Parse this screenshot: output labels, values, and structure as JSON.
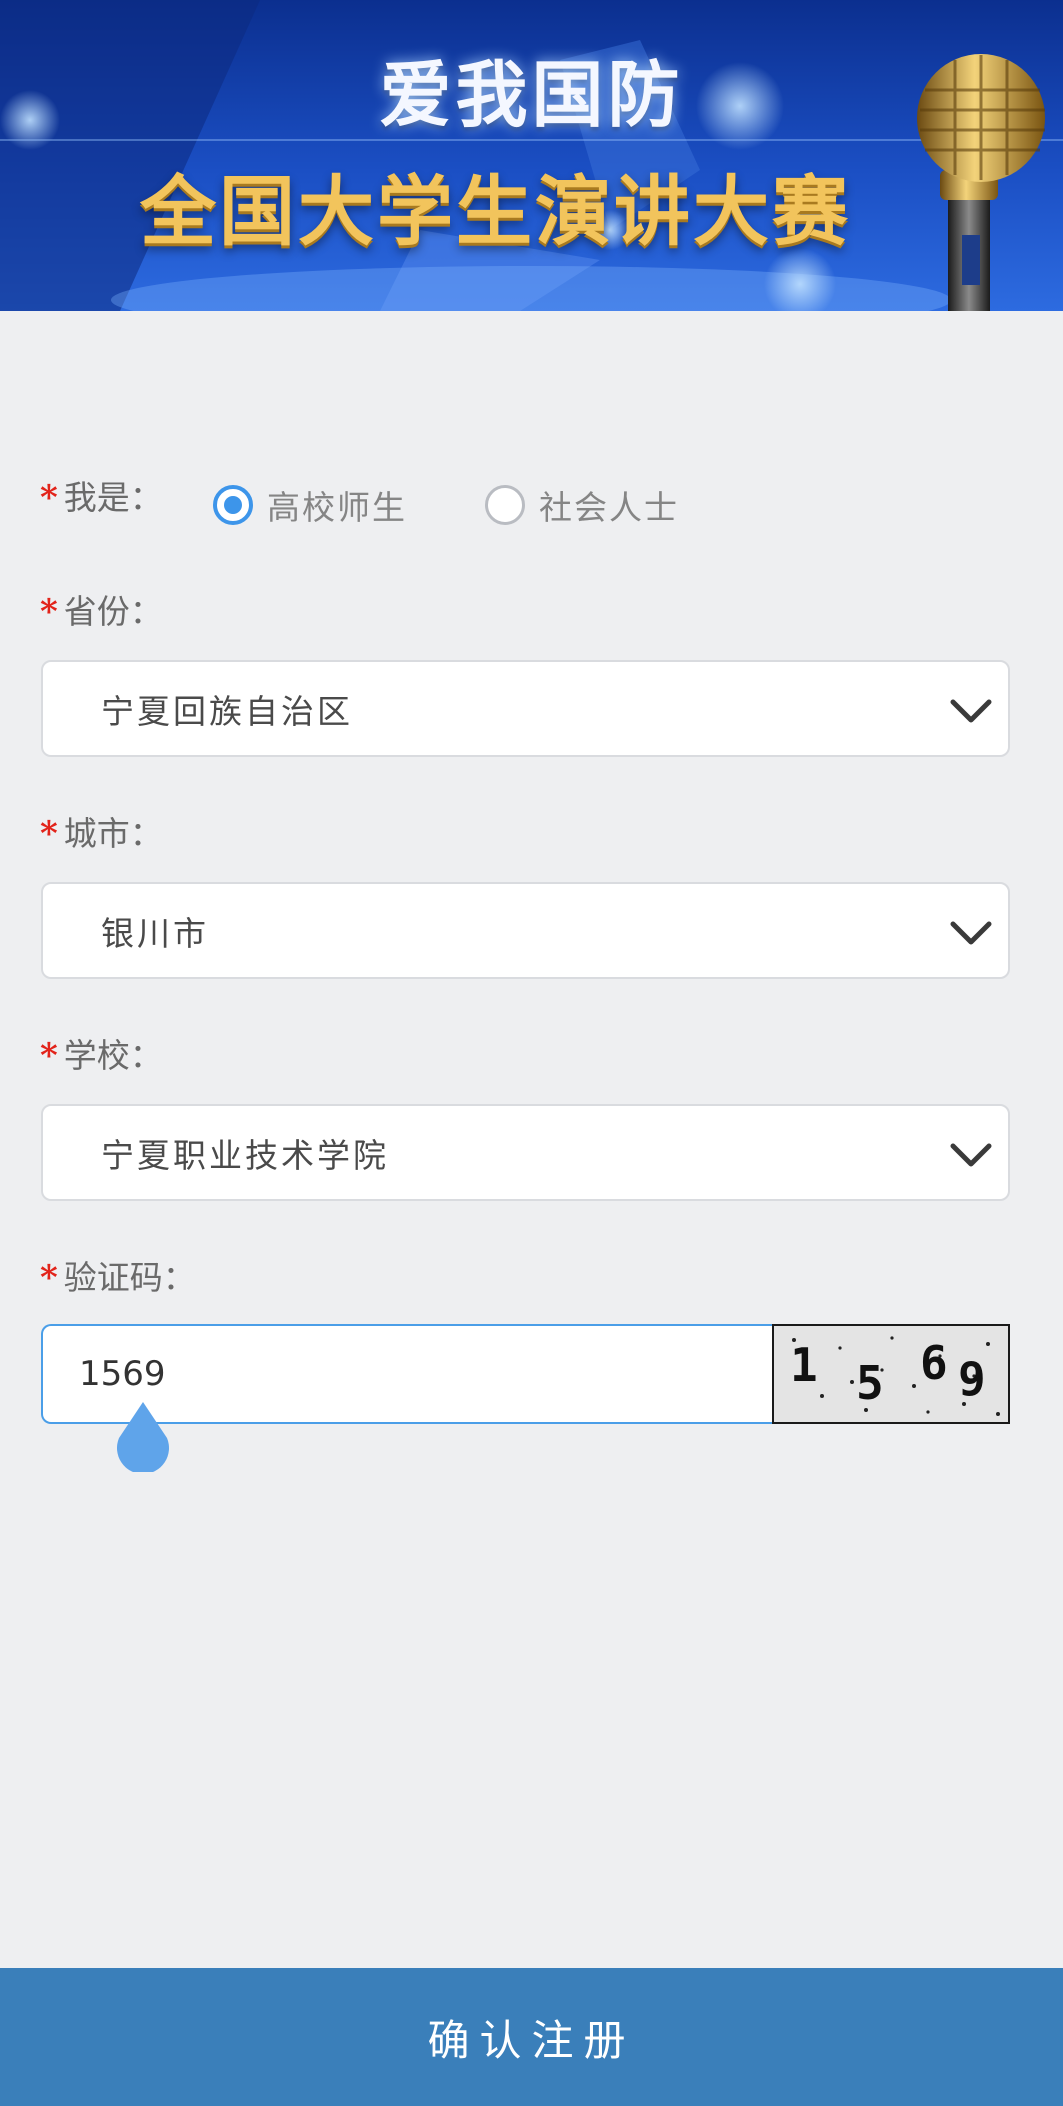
{
  "banner": {
    "title_line1": "爱我国防",
    "title_line2": "全国大学生演讲大赛"
  },
  "form": {
    "identity": {
      "label": "我是：",
      "options": [
        "高校师生",
        "社会人士"
      ],
      "selected": "高校师生"
    },
    "province": {
      "label": "省份：",
      "value": "宁夏回族自治区"
    },
    "city": {
      "label": "城市：",
      "value": "银川市"
    },
    "school": {
      "label": "学校：",
      "value": "宁夏职业技术学院"
    },
    "captcha": {
      "label": "验证码：",
      "input_value": "1569",
      "image_chars": [
        "1",
        "5",
        "6",
        "9"
      ]
    },
    "required_mark": "*"
  },
  "submit": {
    "label": "确认注册"
  },
  "colors": {
    "accent": "#3d95ea",
    "required": "#e2231a",
    "submit_bar": "#3a7fba"
  }
}
